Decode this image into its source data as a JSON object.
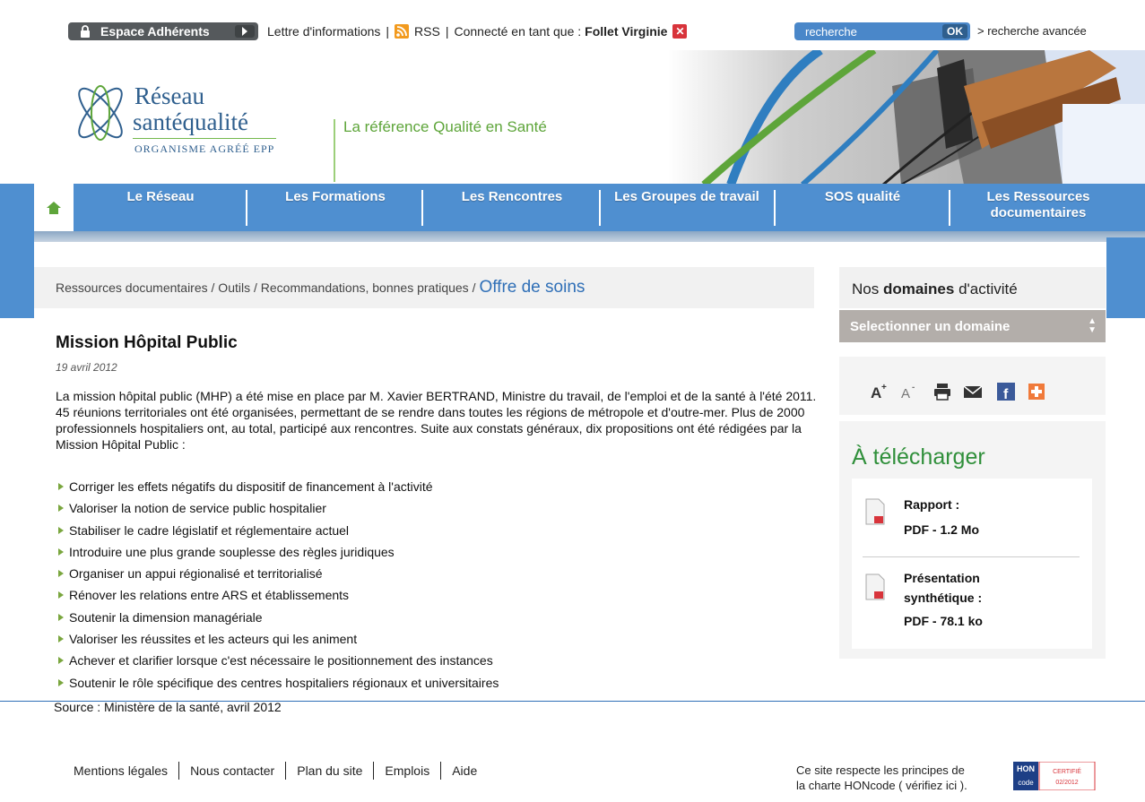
{
  "topbar": {
    "espace_label": "Espace Adhérents",
    "newsletter_label": "Lettre d'informations",
    "sep": "|",
    "rss_label": "RSS",
    "connected_label": "Connecté en tant que :",
    "user_name": "Follet Virginie",
    "search_placeholder": "recherche",
    "search_ok": "OK",
    "advanced_search": "> recherche avancée"
  },
  "logo": {
    "line1": "Réseau",
    "line2": "santéqualité",
    "subtitle": "ORGANISME AGRÉÉ EPP",
    "slogan": "La référence Qualité en Santé"
  },
  "nav": {
    "items": [
      {
        "label": "Le Réseau"
      },
      {
        "label": "Les Formations"
      },
      {
        "label": "Les Rencontres"
      },
      {
        "label": "Les Groupes de travail"
      },
      {
        "label": "SOS qualité"
      },
      {
        "label": "Les Ressources documentaires"
      }
    ]
  },
  "breadcrumb": {
    "path": "Ressources documentaires / Outils / Recommandations, bonnes pratiques /",
    "current": "Offre de soins"
  },
  "article": {
    "title": "Mission Hôpital Public",
    "date": "19 avril 2012",
    "body": "La mission hôpital public (MHP) a été mise en place par M. Xavier BERTRAND, Ministre du travail, de l'emploi et de la santé à l'été 2011. 45 réunions territoriales ont été organisées, permettant de se rendre dans toutes les régions de métropole et d'outre-mer. Plus de 2000 professionnels hospitaliers ont, au total, participé aux rencontres. Suite aux constats généraux, dix propositions ont été rédigées par la Mission Hôpital Public :",
    "bullets": [
      "Corriger les effets négatifs du dispositif de financement à l'activité",
      "Valoriser la notion de service public hospitalier",
      "Stabiliser le cadre législatif et réglementaire actuel",
      "Introduire une plus grande souplesse des règles juridiques",
      "Organiser un appui régionalisé et territorialisé",
      "Rénover les relations entre ARS et établissements",
      "Soutenir la dimension managériale",
      "Valoriser les réussites et les acteurs qui les animent",
      "Achever et clarifier lorsque c'est nécessaire le positionnement des instances",
      "Soutenir le rôle spécifique des centres hospitaliers régionaux et universitaires"
    ],
    "source": "Source : Ministère de la santé, avril 2012"
  },
  "sidebar": {
    "domains_prefix": "Nos",
    "domains_bold": "domaines",
    "domains_suffix": "d'activité",
    "select_label": "Selectionner un domaine",
    "download_title": "À télécharger",
    "downloads": [
      {
        "title": "Rapport :",
        "meta": "PDF - 1.2 Mo"
      },
      {
        "title1": "Présentation",
        "title2": "synthétique :",
        "meta": "PDF - 78.1 ko"
      }
    ]
  },
  "footer": {
    "links": [
      "Mentions légales",
      "Nous contacter",
      "Plan du site",
      "Emplois",
      "Aide"
    ],
    "hon_line1": "Ce site respecte les principes de",
    "hon_line2": "la charte HONcode ( vérifiez ici ).",
    "hon_badge_top": "HON",
    "hon_badge_code": "code",
    "hon_certified": "CERTIFIÉ",
    "hon_date": "02/2012"
  },
  "colors": {
    "nav_blue": "#4f8fd0",
    "accent_green": "#5ea53a",
    "link_blue": "#2f6fb7",
    "select_grey": "#b3aeaa"
  },
  "icons": [
    "lock-icon",
    "arrow-right-icon",
    "rss-icon",
    "close-icon",
    "home-icon",
    "increase-font-icon",
    "decrease-font-icon",
    "print-icon",
    "email-icon",
    "facebook-icon",
    "share-plus-icon",
    "pdf-icon"
  ]
}
